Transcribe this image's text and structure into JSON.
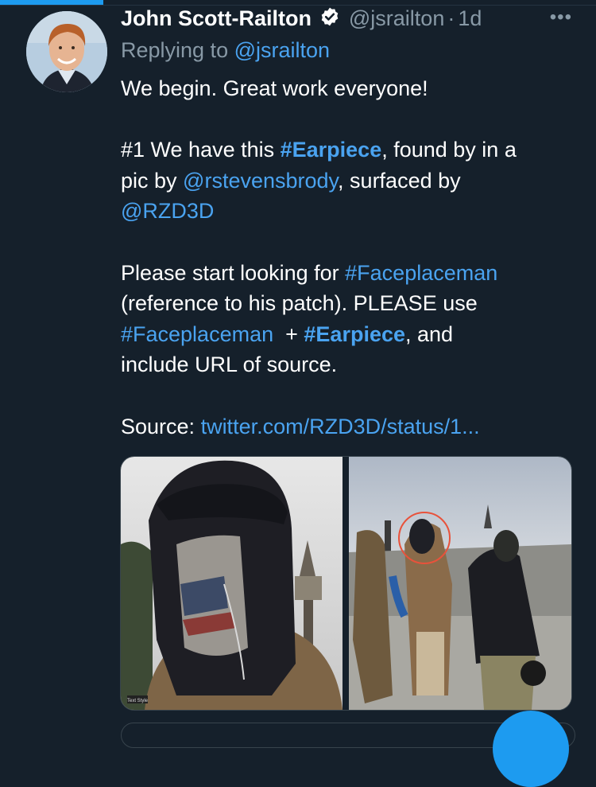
{
  "tweet": {
    "author_name": "John Scott-Railton",
    "handle": "@jsrailton",
    "dot": "·",
    "time": "1d",
    "more_label": "•••",
    "reply_prefix": "Replying to ",
    "reply_to": "@jsrailton",
    "lines": {
      "l1": "We begin. Great work everyone!",
      "l2a": "#1 We have this ",
      "l2b": "#Earpiece",
      "l2c": ", found by in a",
      "l3a": "pic by ",
      "l3b": "@rstevensbrody",
      "l3c": ", surfaced by",
      "l4": "@RZD3D",
      "l5a": "Please start looking for ",
      "l5b": "#Faceplaceman",
      "l6": "(reference to his patch). PLEASE use",
      "l7a": "#Faceplaceman",
      "l7b": "  + ",
      "l7c": "#Earpiece",
      "l7d": ", and",
      "l8": "include URL of source.",
      "l9a": "Source: ",
      "l9b": "twitter.com/RZD3D/status/1..."
    },
    "media_caption": "Text Style"
  },
  "icons": {
    "verified": "verified-badge-icon",
    "more": "more-options-icon"
  },
  "colors": {
    "background": "#15202b",
    "link": "#4aa3f0",
    "secondary_text": "#8899a6",
    "accent": "#1d9bf0"
  }
}
